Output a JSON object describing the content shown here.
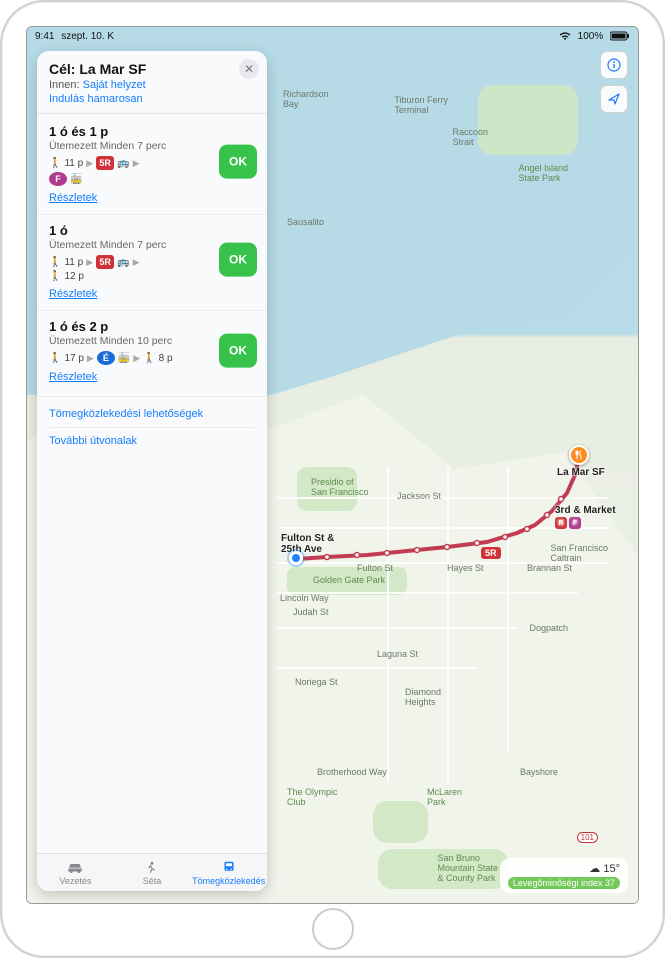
{
  "statusbar": {
    "time": "9:41",
    "date": "szept. 10. K",
    "battery_pct": "100%"
  },
  "map_controls": {
    "info": "i",
    "locate": "➤"
  },
  "weather": {
    "temp": "15°",
    "aqi": "Levegőminőségi index 37"
  },
  "card": {
    "title": "Cél: La Mar SF",
    "from_label": "Innen:",
    "from_value": "Saját helyzet",
    "leaving": "Indulás hamarosan"
  },
  "routes": [
    {
      "time": "1 ó és 1 p",
      "sched": "Ütemezett Minden 7 perc",
      "row1": {
        "walk": "11 p",
        "line_badge": "5R",
        "line_color": "#cf3339",
        "vehicle": "bus"
      },
      "row2": {
        "badge": "F",
        "badge_color": "#b23a8e",
        "vehicle": "tram"
      },
      "go": "OK",
      "details": "Részletek"
    },
    {
      "time": "1 ó",
      "sched": "Ütemezett Minden 7 perc",
      "row1": {
        "walk": "11 p",
        "line_badge": "5R",
        "line_color": "#cf3339",
        "vehicle": "bus"
      },
      "row2": {
        "walk": "12 p"
      },
      "go": "OK",
      "details": "Részletek"
    },
    {
      "time": "1 ó és 2 p",
      "sched": "Ütemezett Minden 10 perc",
      "row1": {
        "walk": "17 p",
        "circle_badge": "É",
        "circle_color": "#1b6bd6",
        "vehicle": "tram",
        "walk_after": "8 p"
      },
      "go": "OK",
      "details": "Részletek"
    }
  ],
  "links": {
    "transit_options": "Tömegközlekedési lehetőségek",
    "more_routes": "További útvonalak"
  },
  "tabs": {
    "drive": "Vezetés",
    "walk": "Séta",
    "transit": "Tömegközlekedés"
  },
  "map_labels": {
    "richardson_bay": "Richardson\nBay",
    "tiburon": "Tiburon Ferry\nTerminal",
    "raccoon": "Raccoon\nStrait",
    "angel": "Angel Island\nState Park",
    "sausalito": "Sausalito",
    "presidio": "Presidio of\nSan Francisco",
    "jackson": "Jackson St",
    "fulton": "Fulton St",
    "lincoln": "Lincoln Way",
    "judah": "Judah St",
    "laguna": "Laguna St",
    "noriega": "Noriega St",
    "diamond": "Diamond\nHeights",
    "brotherhood": "Brotherhood Way",
    "olympic": "The Olympic\nClub",
    "mclaren": "McLaren\nPark",
    "bayshore": "Bayshore",
    "sanbruno": "San Bruno\nMountain State\n& County Park",
    "sfcal": "San Francisco\nCaltrain",
    "dogpatch": "Dogpatch",
    "brannan": "Brannan St",
    "hayes": "Hayes St",
    "ggpark": "Golden Gate Park",
    "hwy101": "101",
    "route_badge": "5R"
  },
  "stops": {
    "origin": "Fulton St &\n25th Ave",
    "dest": "La Mar SF",
    "transfer": "3rd & Market"
  }
}
